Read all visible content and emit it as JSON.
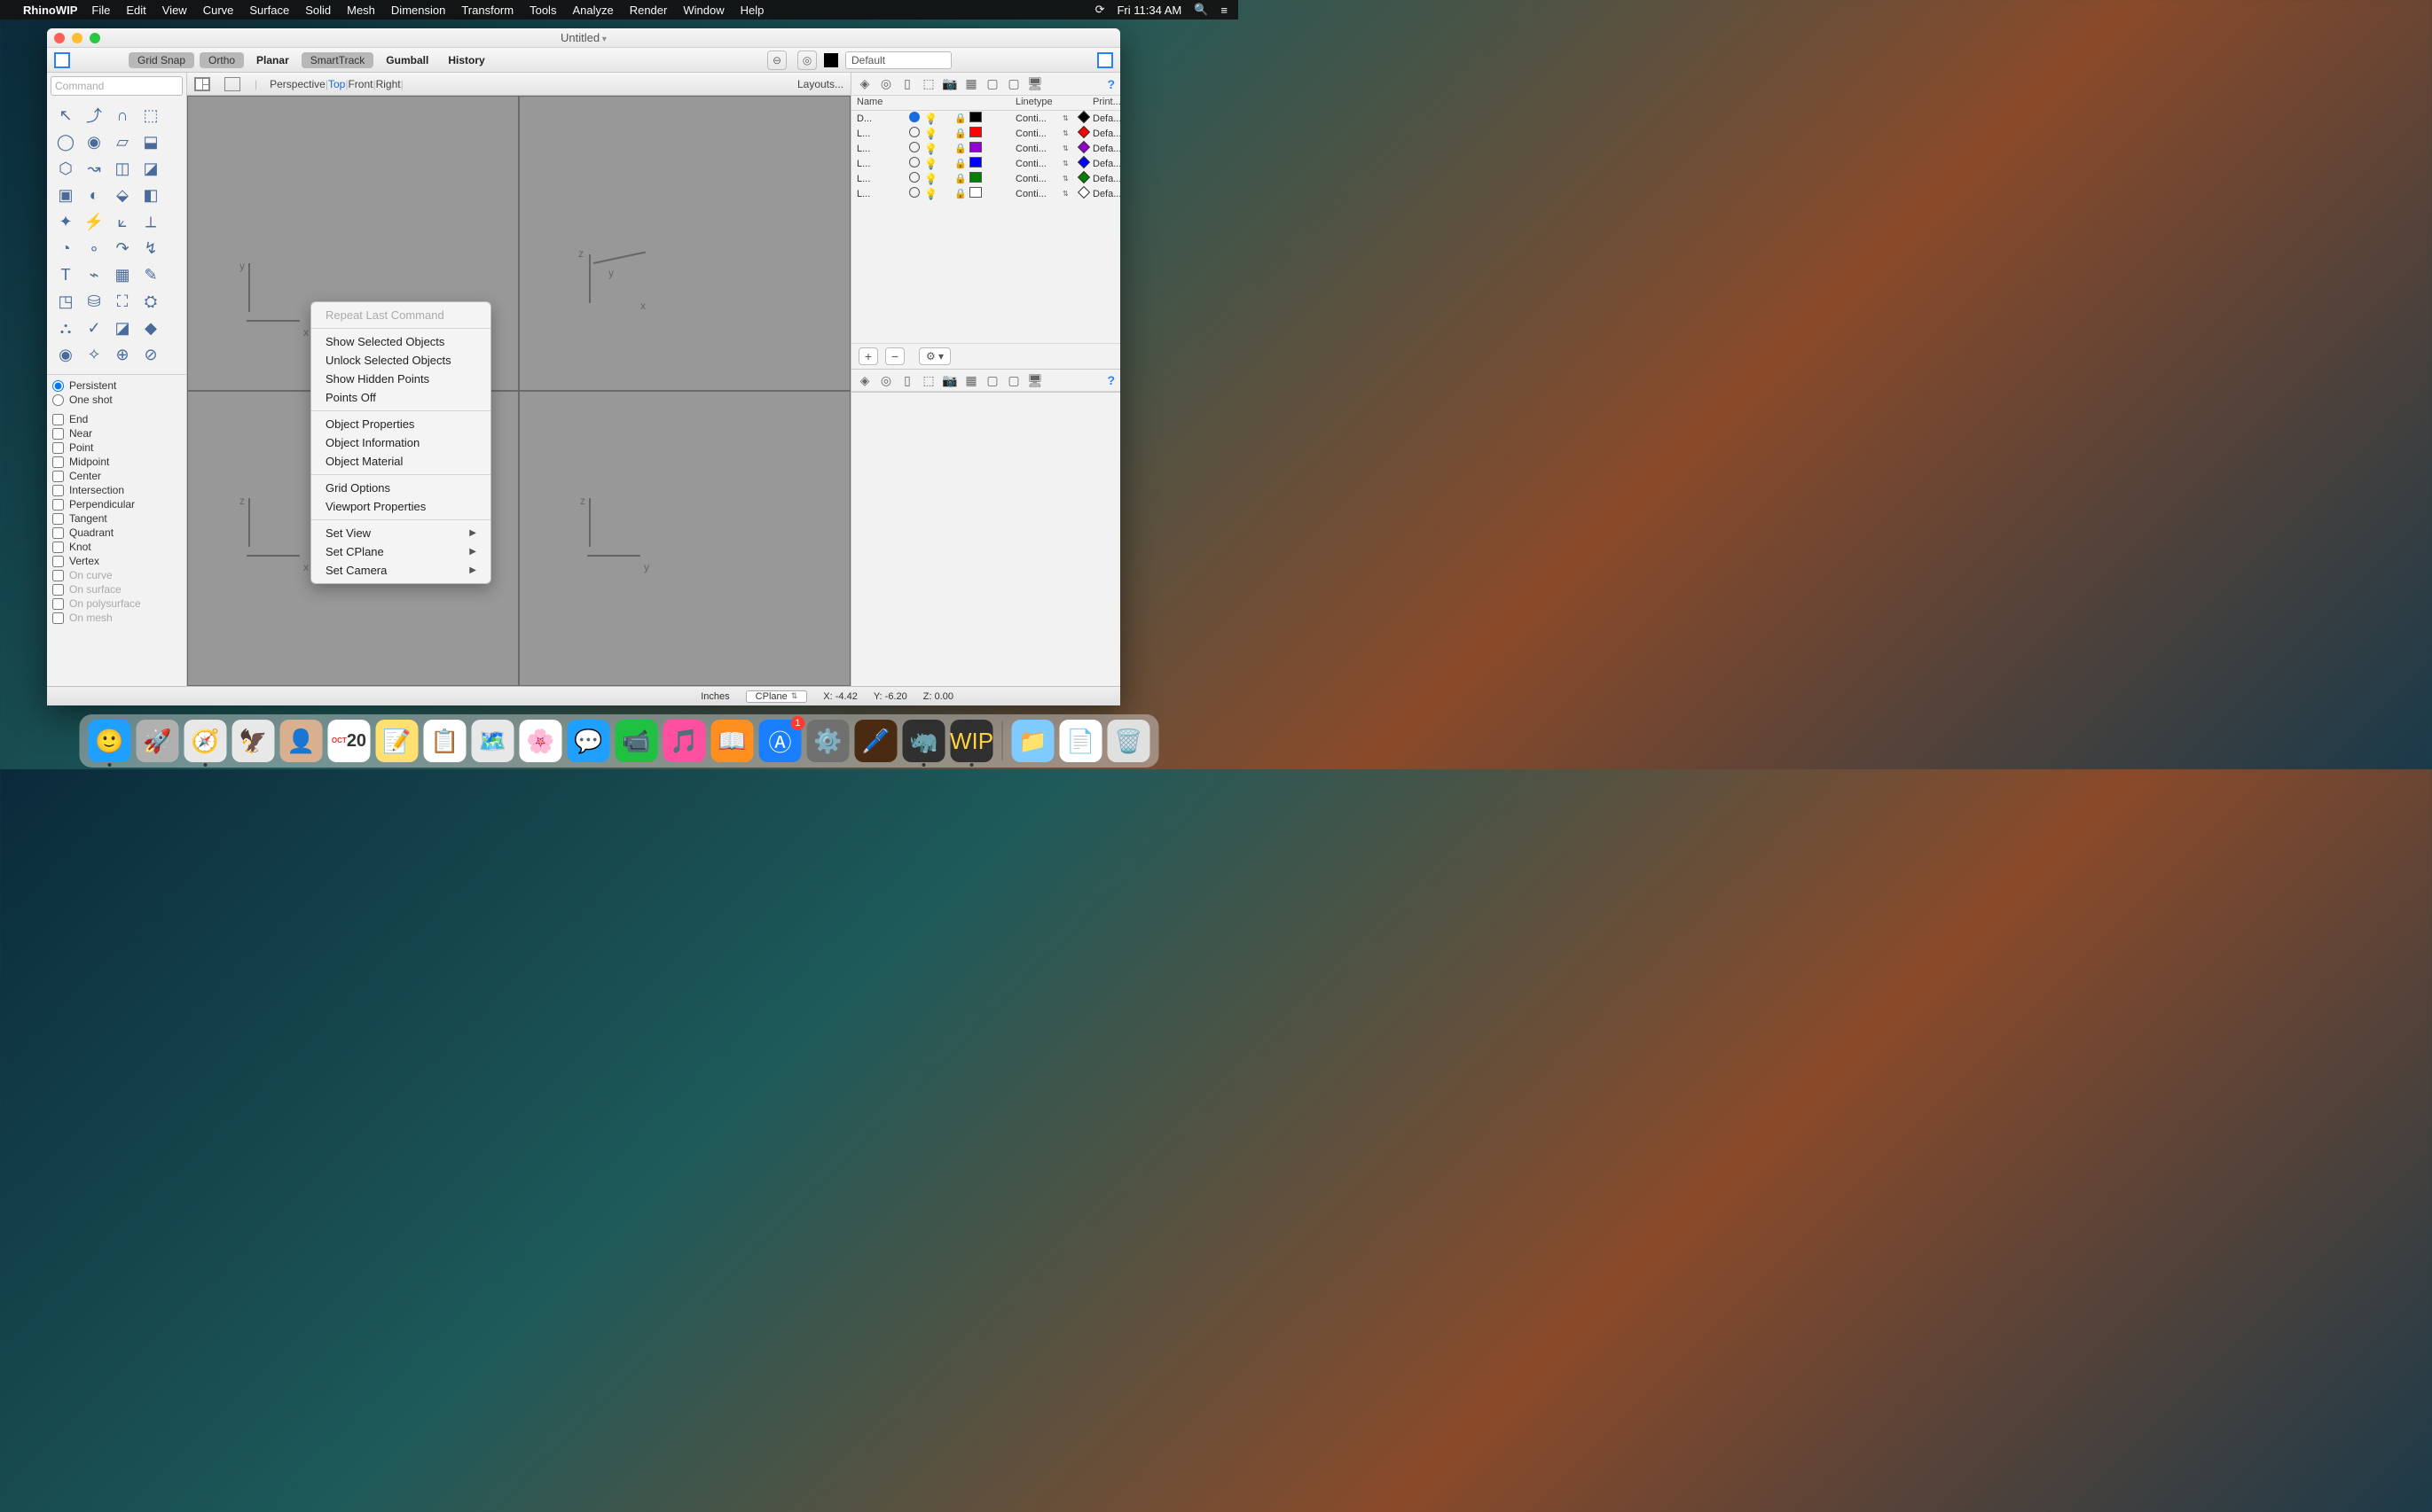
{
  "menubar": {
    "app": "RhinoWIP",
    "items": [
      "File",
      "Edit",
      "View",
      "Curve",
      "Surface",
      "Solid",
      "Mesh",
      "Dimension",
      "Transform",
      "Tools",
      "Analyze",
      "Render",
      "Window",
      "Help"
    ],
    "clock": "Fri 11:34 AM"
  },
  "window": {
    "title": "Untitled"
  },
  "snapbar": {
    "buttons": [
      "Grid Snap",
      "Ortho",
      "Planar",
      "SmartTrack",
      "Gumball",
      "History"
    ],
    "active": [
      true,
      true,
      false,
      true,
      false,
      false
    ],
    "layer_select": "Default"
  },
  "command_placeholder": "Command",
  "osnap": {
    "mode_persistent": "Persistent",
    "mode_oneshot": "One shot",
    "checks": [
      "End",
      "Near",
      "Point",
      "Midpoint",
      "Center",
      "Intersection",
      "Perpendicular",
      "Tangent",
      "Quadrant",
      "Knot",
      "Vertex",
      "On curve",
      "On surface",
      "On polysurface",
      "On mesh"
    ],
    "dim_start_index": 11
  },
  "viewport_tabs": {
    "items": [
      "Perspective",
      "Top",
      "Front",
      "Right"
    ],
    "active_index": 1,
    "layouts": "Layouts..."
  },
  "context_menu": {
    "groups": [
      [
        {
          "label": "Repeat Last Command",
          "disabled": true
        }
      ],
      [
        {
          "label": "Show Selected Objects"
        },
        {
          "label": "Unlock Selected Objects"
        },
        {
          "label": "Show Hidden Points"
        },
        {
          "label": "Points Off"
        }
      ],
      [
        {
          "label": "Object Properties"
        },
        {
          "label": "Object Information"
        },
        {
          "label": "Object Material"
        }
      ],
      [
        {
          "label": "Grid Options"
        },
        {
          "label": "Viewport Properties"
        }
      ],
      [
        {
          "label": "Set View",
          "submenu": true
        },
        {
          "label": "Set CPlane",
          "submenu": true
        },
        {
          "label": "Set Camera",
          "submenu": true
        }
      ]
    ]
  },
  "layers": {
    "headers": {
      "name": "Name",
      "linetype": "Linetype",
      "print": "Print..."
    },
    "rows": [
      {
        "name": "D...",
        "current": true,
        "color": "#000000",
        "linetype": "Conti...",
        "print": "Defa...",
        "diamond": "#000000"
      },
      {
        "name": "L...",
        "current": false,
        "color": "#ff0000",
        "linetype": "Conti...",
        "print": "Defa...",
        "diamond": "#ff0000"
      },
      {
        "name": "L...",
        "current": false,
        "color": "#9400d3",
        "linetype": "Conti...",
        "print": "Defa...",
        "diamond": "#9400d3"
      },
      {
        "name": "L...",
        "current": false,
        "color": "#0000ff",
        "linetype": "Conti...",
        "print": "Defa...",
        "diamond": "#0000ff"
      },
      {
        "name": "L...",
        "current": false,
        "color": "#008000",
        "linetype": "Conti...",
        "print": "Defa...",
        "diamond": "#008000"
      },
      {
        "name": "L...",
        "current": false,
        "color": "#ffffff",
        "linetype": "Conti...",
        "print": "Defa...",
        "diamond": "#ffffff"
      }
    ]
  },
  "statusbar": {
    "units": "Inches",
    "cplane": "CPlane",
    "x": "X: -4.42",
    "y": "Y: -6.20",
    "z": "Z: 0.00"
  },
  "dock": {
    "apps": [
      {
        "name": "finder",
        "glyph": "🙂",
        "bg": "#1fa0ff",
        "dot": true
      },
      {
        "name": "launchpad",
        "glyph": "🚀",
        "bg": "#b0b0b0"
      },
      {
        "name": "safari",
        "glyph": "🧭",
        "bg": "#e8e8e8",
        "dot": true
      },
      {
        "name": "mail",
        "glyph": "🦅",
        "bg": "#e8e8e8"
      },
      {
        "name": "contacts",
        "glyph": "👤",
        "bg": "#d8b090"
      },
      {
        "name": "calendar",
        "glyph": "20",
        "bg": "#ffffff",
        "text": "#e03030"
      },
      {
        "name": "notes",
        "glyph": "📝",
        "bg": "#ffe070"
      },
      {
        "name": "reminders",
        "glyph": "📋",
        "bg": "#ffffff"
      },
      {
        "name": "maps",
        "glyph": "🗺️",
        "bg": "#e8e8e8"
      },
      {
        "name": "photos",
        "glyph": "🌸",
        "bg": "#ffffff"
      },
      {
        "name": "messages",
        "glyph": "💬",
        "bg": "#1fa0ff"
      },
      {
        "name": "facetime",
        "glyph": "📹",
        "bg": "#20c040"
      },
      {
        "name": "itunes",
        "glyph": "🎵",
        "bg": "#ff4fa0"
      },
      {
        "name": "ibooks",
        "glyph": "📖",
        "bg": "#ff9020"
      },
      {
        "name": "appstore",
        "glyph": "Ⓐ",
        "bg": "#1a7fff",
        "badge": "1"
      },
      {
        "name": "preferences",
        "glyph": "⚙️",
        "bg": "#707070"
      },
      {
        "name": "illustrator",
        "glyph": "🖊️",
        "bg": "#4a2a10"
      },
      {
        "name": "rhino5",
        "glyph": "🦏",
        "bg": "#303030",
        "dot": true
      },
      {
        "name": "rhinowip",
        "glyph": "WIP",
        "bg": "#303030",
        "dot": true,
        "text": "#ffd040"
      }
    ],
    "right": [
      {
        "name": "downloads",
        "glyph": "📁",
        "bg": "#7fcaff"
      },
      {
        "name": "document",
        "glyph": "📄",
        "bg": "#ffffff"
      },
      {
        "name": "trash",
        "glyph": "🗑️",
        "bg": "#e0e0e0"
      }
    ]
  },
  "axes": {
    "vp1": {
      "v": "y",
      "h": "x"
    },
    "vp2": {
      "v": "z",
      "h": "x",
      "d": "y"
    },
    "vp3": {
      "v": "z",
      "h": "x"
    },
    "vp4": {
      "v": "z",
      "h": "y"
    }
  }
}
